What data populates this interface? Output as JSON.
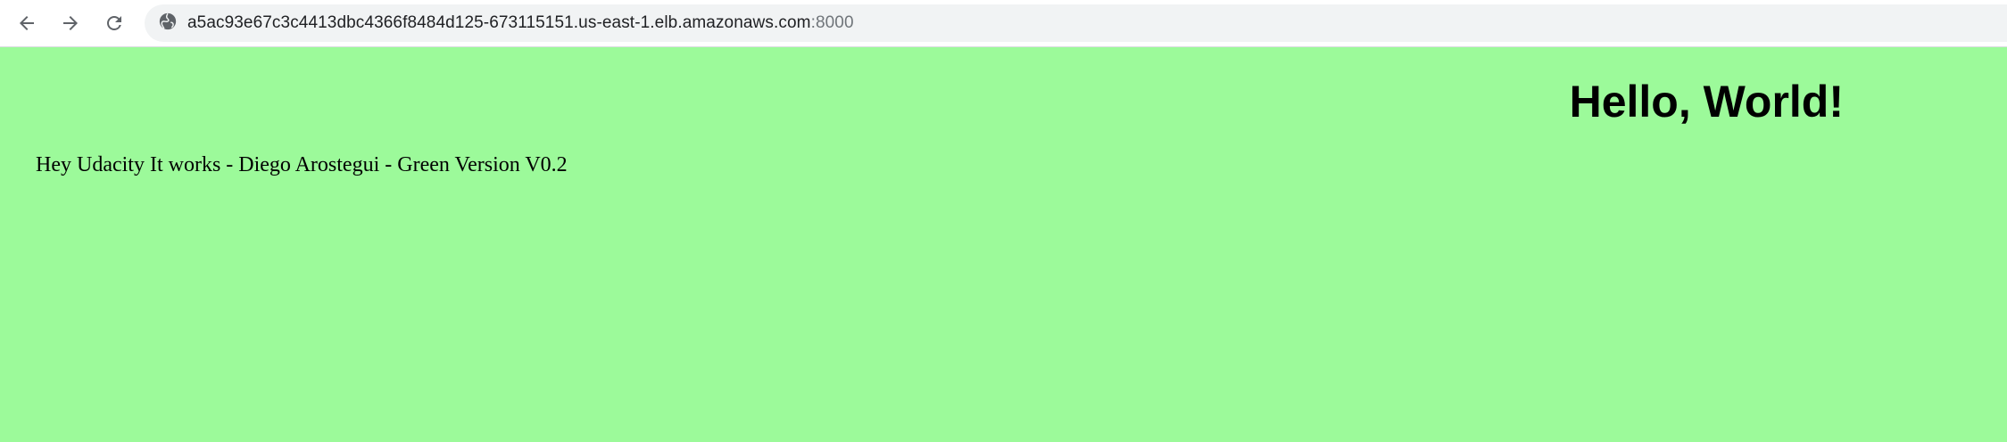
{
  "browser": {
    "url_main": "a5ac93e67c3c4413dbc4366f8484d125-673115151.us-east-1.elb.amazonaws.com",
    "url_port": ":8000",
    "icons": {
      "back": "arrow-back-icon",
      "forward": "arrow-forward-icon",
      "reload": "reload-icon",
      "site_info": "globe-icon"
    }
  },
  "page": {
    "background_color": "#9cfa9a",
    "heading": "Hello, World!",
    "message": "Hey Udacity It works - Diego Arostegui - Green Version V0.2"
  }
}
